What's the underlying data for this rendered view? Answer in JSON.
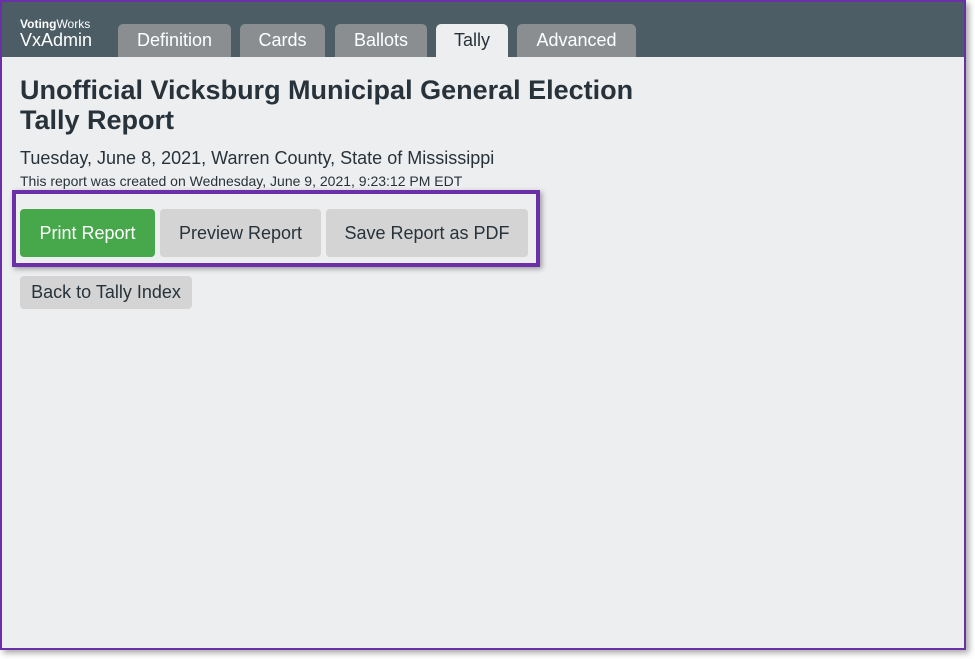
{
  "app": {
    "brand_bold": "Voting",
    "brand_light": "Works",
    "product": "VxAdmin"
  },
  "tabs": [
    {
      "label": "Definition",
      "active": false
    },
    {
      "label": "Cards",
      "active": false
    },
    {
      "label": "Ballots",
      "active": false
    },
    {
      "label": "Tally",
      "active": true
    },
    {
      "label": "Advanced",
      "active": false
    }
  ],
  "report": {
    "title_line1": "Unofficial Vicksburg Municipal General Election",
    "title_line2": "Tally Report",
    "subtitle": "Tuesday, June 8, 2021, Warren County, State of Mississippi",
    "created": "This report was created on Wednesday, June 9, 2021, 9:23:12 PM EDT"
  },
  "actions": {
    "print": "Print Report",
    "preview": "Preview Report",
    "save_pdf": "Save Report as PDF",
    "back": "Back to Tally Index"
  },
  "colors": {
    "header_bg": "#4c5d66",
    "tab_inactive": "#8a8e91",
    "page_bg": "#edeef0",
    "primary": "#47a84b",
    "highlight": "#6b2fa8"
  }
}
